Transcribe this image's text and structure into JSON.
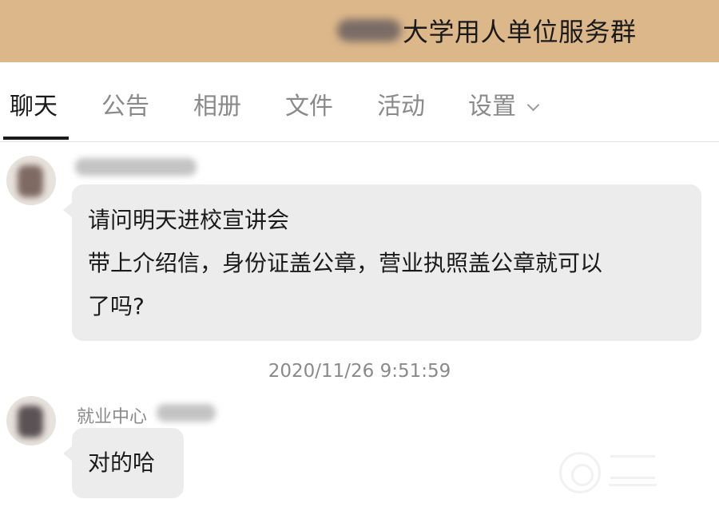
{
  "header": {
    "group_name": "大学用人单位服务群"
  },
  "tabs": [
    {
      "label": "聊天",
      "active": true
    },
    {
      "label": "公告",
      "active": false
    },
    {
      "label": "相册",
      "active": false
    },
    {
      "label": "文件",
      "active": false
    },
    {
      "label": "活动",
      "active": false
    },
    {
      "label": "设置",
      "active": false
    }
  ],
  "messages": [
    {
      "sender": "",
      "lines": [
        "请问明天进校宣讲会",
        "带上介绍信，身份证盖公章，营业执照盖公章就可以",
        "了吗?"
      ]
    },
    {
      "sender": "就业中心",
      "lines": [
        "对的哈"
      ]
    }
  ],
  "timestamp": "2020/11/26 9:51:59",
  "colors": {
    "header_bg": "#dcb78a",
    "bubble_bg": "#ececec",
    "muted_text": "#8a8a8a"
  },
  "icons": [
    "chevron-down-icon",
    "avatar"
  ]
}
